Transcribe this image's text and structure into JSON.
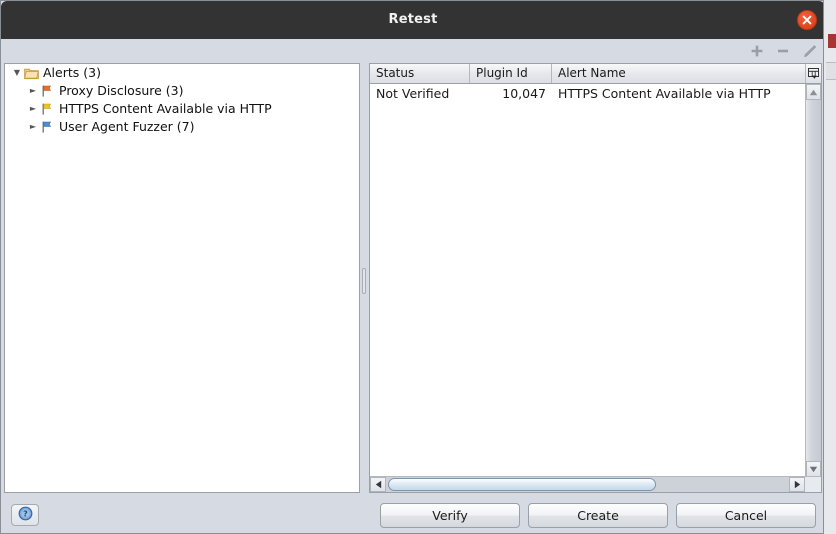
{
  "window": {
    "title": "Retest",
    "close_icon": "close-icon"
  },
  "toolbar": {
    "add_icon": "plus-icon",
    "remove_icon": "minus-icon",
    "edit_icon": "pencil-icon"
  },
  "tree": {
    "root": {
      "label": "Alerts (3)",
      "icon": "folder-icon",
      "expanded": true,
      "toggle": "▼"
    },
    "children": [
      {
        "label": "Proxy Disclosure (3)",
        "icon": "flag-icon",
        "flag_color": "#e8702a",
        "toggle": "►"
      },
      {
        "label": "HTTPS Content Available via HTTP",
        "icon": "flag-icon",
        "flag_color": "#f0c420",
        "toggle": "►"
      },
      {
        "label": "User Agent Fuzzer (7)",
        "icon": "flag-icon",
        "flag_color": "#4a90d9",
        "toggle": "►"
      }
    ]
  },
  "table": {
    "columns": [
      "Status",
      "Plugin Id",
      "Alert Name"
    ],
    "column_chooser_icon": "column-settings-icon",
    "rows": [
      {
        "status": "Not Verified",
        "plugin_id": "10,047",
        "alert_name": "HTTPS Content Available via HTTP"
      }
    ]
  },
  "scrollbars": {
    "v_up_icon": "arrow-up-icon",
    "v_down_icon": "arrow-down-icon",
    "h_left_icon": "arrow-left-icon",
    "h_right_icon": "arrow-right-icon"
  },
  "footer": {
    "help_icon": "help-icon",
    "verify_label": "Verify",
    "create_label": "Create",
    "cancel_label": "Cancel"
  },
  "colors": {
    "titlebar": "#333333",
    "close": "#e04620",
    "panel_bg": "#d6dae2",
    "accent_blue": "#4a90d9"
  }
}
